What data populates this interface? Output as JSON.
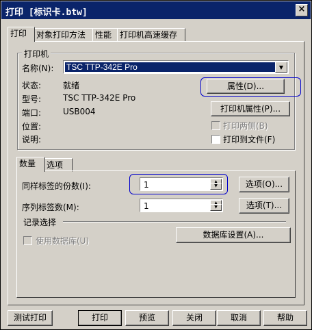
{
  "window": {
    "title": "打印 [标识卡.btw]",
    "close": "×"
  },
  "tabs": [
    "打印",
    "对象打印方法",
    "性能",
    "打印机高速缓存"
  ],
  "printer_group": {
    "label": "打印机",
    "name_label": "名称(N):",
    "name_value": "TSC TTP-342E Pro",
    "status_label": "状态:",
    "status_value": "就绪",
    "model_label": "型号:",
    "model_value": "TSC TTP-342E Pro",
    "port_label": "端口:",
    "port_value": "USB004",
    "location_label": "位置:",
    "comment_label": "说明:",
    "properties_btn": "属性(D)...",
    "printer_properties_btn": "打印机属性(P)...",
    "duplex_label": "打印两侧(B)",
    "print_to_file_label": "打印到文件(F)"
  },
  "inner_tabs": [
    "数量",
    "选项"
  ],
  "quantity": {
    "copies_label": "同样标签的份数(I):",
    "copies_value": "1",
    "copies_options_btn": "选项(O)...",
    "serial_label": "序列标签数(M):",
    "serial_value": "1",
    "serial_options_btn": "选项(T)...",
    "record_label": "记录选择",
    "use_db_label": "使用数据库(U)",
    "db_settings_btn": "数据库设置(A)..."
  },
  "footer": {
    "test_print": "测试打印",
    "print": "打印",
    "preview": "预览",
    "close": "关闭",
    "cancel": "取消",
    "help": "帮助"
  }
}
